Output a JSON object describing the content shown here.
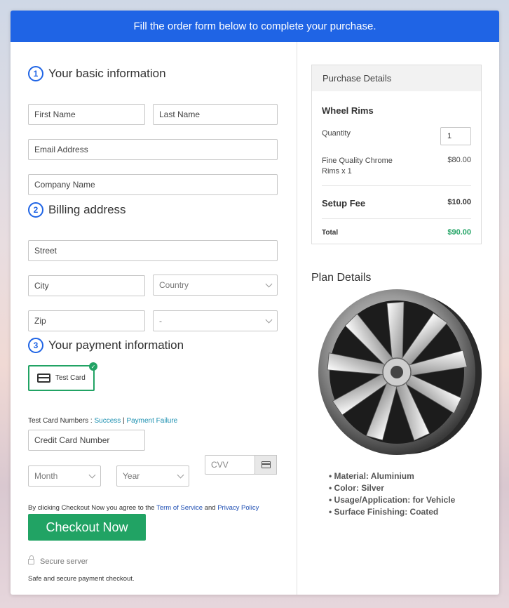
{
  "banner": {
    "text": "Fill the order form below to complete your purchase."
  },
  "sections": {
    "basic": {
      "num": "1",
      "title": "Your basic information"
    },
    "billing": {
      "num": "2",
      "title": "Billing address"
    },
    "payment": {
      "num": "3",
      "title": "Your payment information"
    }
  },
  "fields": {
    "first_name": "First Name",
    "last_name": "Last Name",
    "email": "Email Address",
    "company": "Company Name",
    "street": "Street",
    "city": "City",
    "country": "Country",
    "zip": "Zip",
    "state": "-",
    "credit_card": "Credit Card Number",
    "month": "Month",
    "year": "Year",
    "cvv": "CVV"
  },
  "payment": {
    "test_card_label": "Test Card",
    "test_numbers_label": "Test Card Numbers : ",
    "success_link": "Success",
    "separator": " | ",
    "failure_link": "Payment Failure"
  },
  "terms": {
    "prefix": "By clicking Checkout Now you agree to the ",
    "tos": "Term of Service",
    "and": " and ",
    "privacy": "Privacy Policy"
  },
  "checkout": {
    "button": "Checkout Now",
    "secure": "Secure server",
    "note": "Safe and secure payment checkout."
  },
  "purchase": {
    "header": "Purchase Details",
    "product": "Wheel Rims",
    "quantity_label": "Quantity",
    "quantity_value": "1",
    "item_line1": "Fine Quality Chrome",
    "item_line2": "Rims x 1",
    "item_price": "$80.00",
    "setup_label": "Setup Fee",
    "setup_price": "$10.00",
    "total_label": "Total",
    "total_price": "$90.00"
  },
  "plan": {
    "title": "Plan Details",
    "bullets": [
      "Material: Aluminium",
      "Color: Silver",
      "Usage/Application: for Vehicle",
      "Surface Finishing: Coated"
    ]
  },
  "colors": {
    "accent": "#1f64e5",
    "green": "#21a364",
    "link": "#1a8fb0"
  }
}
